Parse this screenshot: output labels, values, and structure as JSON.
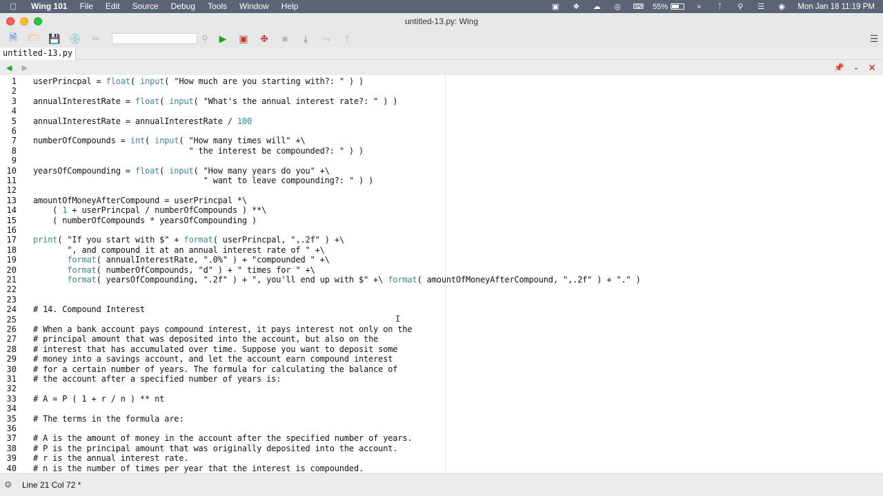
{
  "menubar": {
    "apple_icon": "apple-icon",
    "items": [
      {
        "label": "Wing 101",
        "app": true
      },
      {
        "label": "File"
      },
      {
        "label": "Edit"
      },
      {
        "label": "Source"
      },
      {
        "label": "Debug"
      },
      {
        "label": "Tools"
      },
      {
        "label": "Window"
      },
      {
        "label": "Help"
      }
    ],
    "battery": "55%",
    "clock": "Mon Jan 18  11:19 PM"
  },
  "window": {
    "title": "untitled-13.py: Wing"
  },
  "tab": {
    "label": "untitled-13.py"
  },
  "editor": {
    "lines": [
      "userPrincpal = float( input( \"How much are you starting with?: \" ) )",
      "",
      "annualInterestRate = float( input( \"What's the annual interest rate?: \" ) )",
      "",
      "annualInterestRate = annualInterestRate / 100",
      "",
      "numberOfCompounds = int( input( \"How many times will\" +\\",
      "                                \" the interest be compounded?: \" ) )",
      "",
      "yearsOfCompounding = float( input( \"How many years do you\" +\\",
      "                                   \" want to leave compounding?: \" ) )",
      "",
      "amountOfMoneyAfterCompound = userPrincpal *\\",
      "    ( 1 + userPrincpal / numberOfCompounds ) **\\",
      "    ( numberOfCompounds * yearsOfCompounding )",
      "",
      "print( \"If you start with $\" + format( userPrincpal, \",.2f\" ) +\\",
      "       \", and compound it at an annual interest rate of \" +\\",
      "       format( annualInterestRate, \".0%\" ) + \"compounded \" +\\",
      "       format( numberOfCompounds, \"d\" ) + \" times for \" +\\",
      "       format( yearsOfCompounding, \".2f\" ) + \", you'll end up with $\" +\\ format( amountOfMoneyAfterCompound, \",.2f\" ) + \".\" )",
      "",
      "",
      "# 14. Compound Interest",
      "",
      "# When a bank account pays compound interest, it pays interest not only on the",
      "# principal amount that was deposited into the account, but also on the",
      "# interest that has accumulated over time. Suppose you want to deposit some",
      "# money into a savings account, and let the account earn compound interest",
      "# for a certain number of years. The formula for calculating the balance of",
      "# the account after a specified number of years is:",
      "",
      "# A = P ( 1 + r / n ) ** nt",
      "",
      "# The terms in the formula are:",
      "",
      "# A is the amount of money in the account after the specified number of years.",
      "# P is the principal amount that was originally deposited into the account.",
      "# r is the annual interest rate.",
      "# n is the number of times per year that the interest is compounded."
    ]
  },
  "status": {
    "position": "Line 21 Col 72 *"
  },
  "colors": {
    "keyword": "#3f8a88",
    "number": "#1f8f88",
    "close_red": "#d0201d",
    "run_green": "#2aa02a"
  }
}
